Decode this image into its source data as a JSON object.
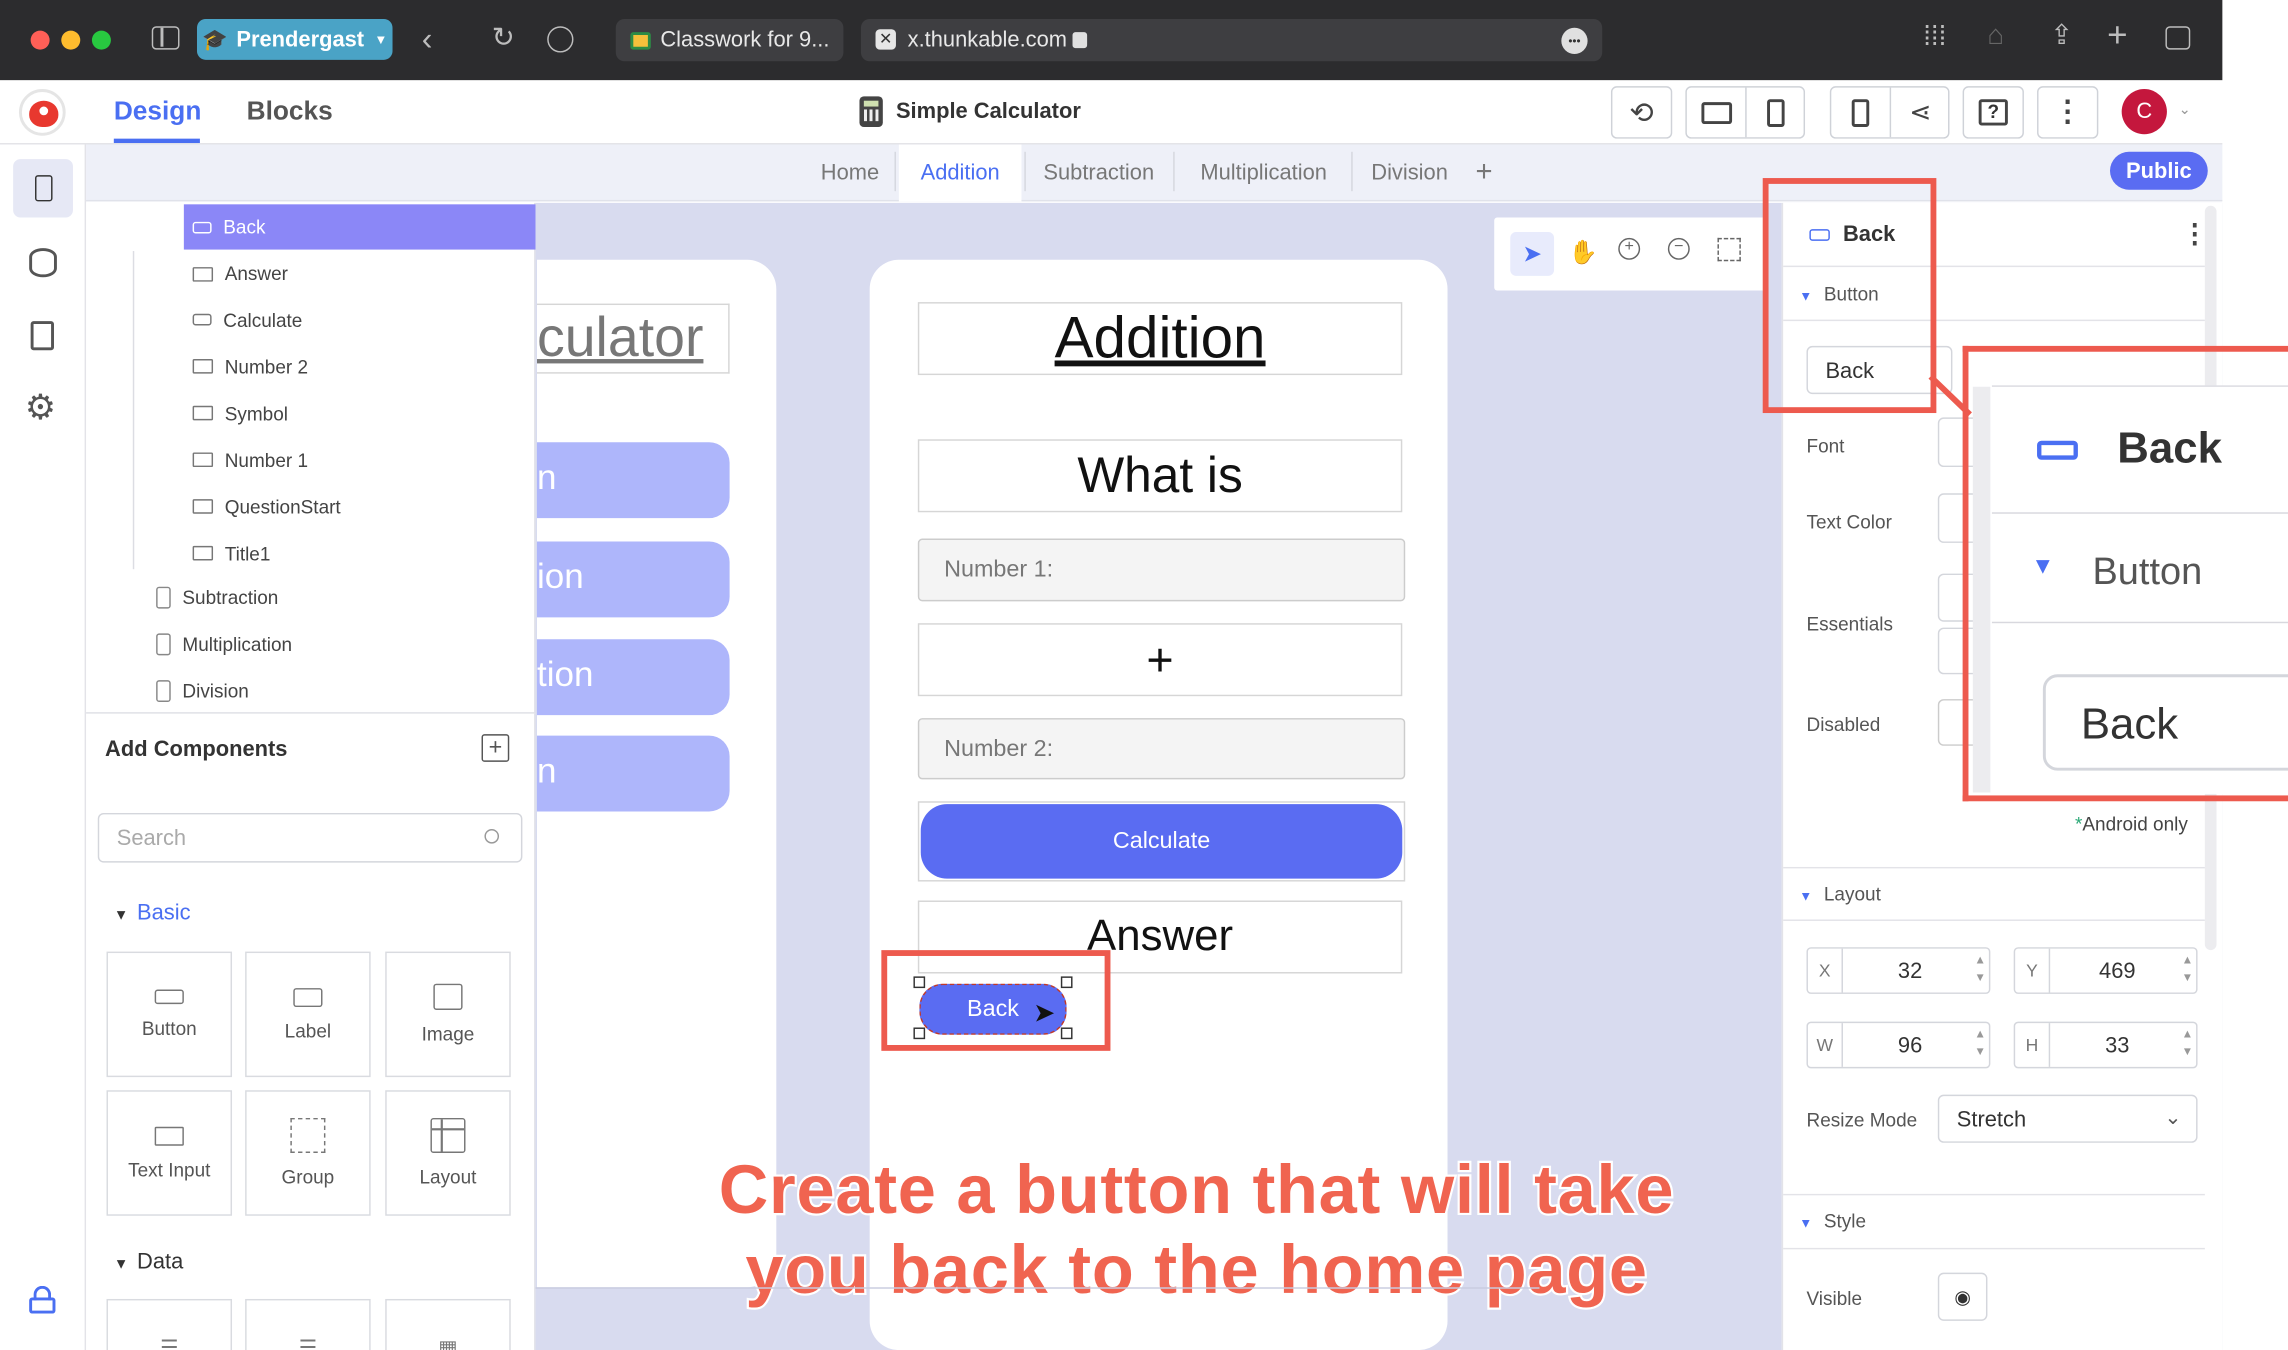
{
  "browser": {
    "profile": "Prendergast",
    "tab1": "Classwork for 9...",
    "tab2": "x.thunkable.com",
    "more": "•••"
  },
  "app": {
    "tab_design": "Design",
    "tab_blocks": "Blocks",
    "project_title": "Simple Calculator",
    "avatar_letter": "C",
    "public_label": "Public"
  },
  "screens": {
    "tabs": [
      "Home",
      "Addition",
      "Subtraction",
      "Multiplication",
      "Division"
    ],
    "active": "Addition",
    "add": "+"
  },
  "tree": {
    "selected": "Back",
    "children": [
      "Answer",
      "Calculate",
      "Number 2",
      "Symbol",
      "Number 1",
      "QuestionStart",
      "Title1"
    ],
    "screens": [
      "Subtraction",
      "Multiplication",
      "Division"
    ]
  },
  "add_components": {
    "title": "Add Components",
    "search_placeholder": "Search",
    "basic_label": "Basic",
    "items": [
      "Button",
      "Label",
      "Image",
      "Text Input",
      "Group",
      "Layout"
    ],
    "data_label": "Data"
  },
  "left_phone": {
    "title": "culator",
    "buttons": [
      "n",
      "ion",
      "tion",
      "n"
    ]
  },
  "phone": {
    "title": "Addition",
    "question": "What is",
    "number1": "Number 1:",
    "symbol": "+",
    "number2": "Number 2:",
    "calculate": "Calculate",
    "answer": "Answer",
    "back": "Back"
  },
  "props": {
    "component": "Back",
    "section_button": "Button",
    "text_value": "Back",
    "font": "Font",
    "text_color": "Text Color",
    "essentials": "Essentials",
    "disabled": "Disabled",
    "android_only": "Android only",
    "layout": "Layout",
    "x_label": "X",
    "x_value": "32",
    "y_label": "Y",
    "y_value": "469",
    "w_label": "W",
    "w_value": "96",
    "h_label": "H",
    "h_value": "33",
    "resize_mode": "Resize Mode",
    "resize_value": "Stretch",
    "style": "Style",
    "visible": "Visible"
  },
  "zoom": {
    "title": "Back",
    "section": "Button",
    "value": "Back"
  },
  "caption": {
    "line1": "Create a button that will take",
    "line2": "you back to the home page"
  },
  "colors": {
    "accent": "#5a6cf2",
    "selected_row": "#8b87f7",
    "red_box": "#ed5a4e",
    "brand_blue": "#4a6ff2"
  }
}
